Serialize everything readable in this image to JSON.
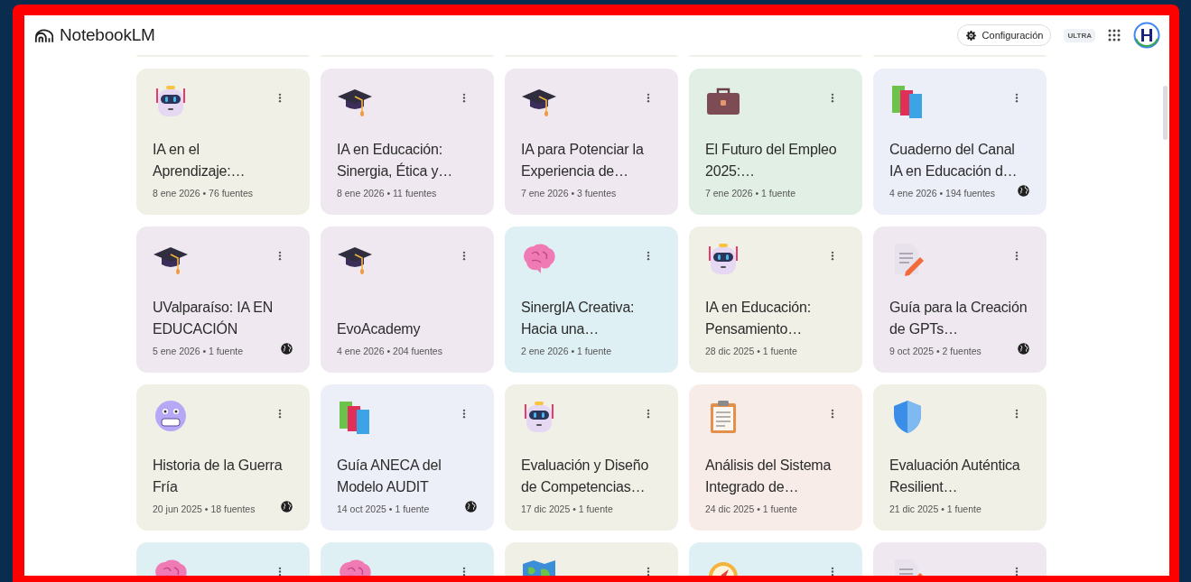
{
  "app": {
    "name": "NotebookLM"
  },
  "header": {
    "settings_label": "Configuración",
    "plan_badge": "ULTRA"
  },
  "notebooks": [
    {
      "kind": "robot",
      "color": "#f1f0e6",
      "title": "IA en el Aprendizaje:…",
      "meta": "8 ene 2026 • 76 fuentes",
      "public": false
    },
    {
      "kind": "cap",
      "color": "#efe8f0",
      "title": "IA en Educación: Sinergia, Ética y…",
      "meta": "8 ene 2026 • 11 fuentes",
      "public": false
    },
    {
      "kind": "cap",
      "color": "#efe8f0",
      "title": "IA para Potenciar la Experiencia de…",
      "meta": "7 ene 2026 • 3 fuentes",
      "public": false
    },
    {
      "kind": "briefcase",
      "color": "#e1efe4",
      "title": "El Futuro del Empleo 2025:…",
      "meta": "7 ene 2026 • 1 fuente",
      "public": false
    },
    {
      "kind": "books",
      "color": "#eceef8",
      "title": "Cuaderno del Canal IA en Educación d…",
      "meta": "4 ene 2026 • 194 fuentes",
      "public": true
    },
    {
      "kind": "cap",
      "color": "#efe8f0",
      "title": "UValparaíso: IA EN EDUCACIÓN",
      "meta": "5 ene 2026 • 1 fuente",
      "public": true
    },
    {
      "kind": "cap",
      "color": "#efe8f0",
      "title": "EvoAcademy",
      "meta": "4 ene 2026 • 204 fuentes",
      "public": false
    },
    {
      "kind": "brain",
      "color": "#dff0f5",
      "title": "SinergIA Creativa: Hacia una…",
      "meta": "2 ene 2026 • 1 fuente",
      "public": false
    },
    {
      "kind": "robot",
      "color": "#f1f0e6",
      "title": "IA en Educación: Pensamiento…",
      "meta": "28 dic 2025 • 1 fuente",
      "public": false
    },
    {
      "kind": "document",
      "color": "#efe8f0",
      "title": "Guía para la Creación de GPTs…",
      "meta": "9 oct 2025 • 2 fuentes",
      "public": true
    },
    {
      "kind": "face",
      "color": "#f1f0e6",
      "title": "Historia de la Guerra Fría",
      "meta": "20 jun 2025 • 18 fuentes",
      "public": true
    },
    {
      "kind": "books",
      "color": "#eceef8",
      "title": "Guía ANECA del Modelo AUDIT",
      "meta": "14 oct 2025 • 1 fuente",
      "public": true
    },
    {
      "kind": "robot",
      "color": "#f1f0e6",
      "title": "Evaluación y Diseño de Competencias…",
      "meta": "17 dic 2025 • 1 fuente",
      "public": false
    },
    {
      "kind": "clipboard",
      "color": "#f7ece8",
      "title": "Análisis del Sistema Integrado de…",
      "meta": "24 dic 2025 • 1 fuente",
      "public": false
    },
    {
      "kind": "shield",
      "color": "#f1f0e6",
      "title": "Evaluación Auténtica Resilient…",
      "meta": "21 dic 2025 • 1 fuente",
      "public": false
    },
    {
      "kind": "brain",
      "color": "#dff0f5"
    },
    {
      "kind": "brain",
      "color": "#dff0f5"
    },
    {
      "kind": "map",
      "color": "#f1f0e6"
    },
    {
      "kind": "compass",
      "color": "#dff0f5"
    },
    {
      "kind": "document",
      "color": "#efe8f0"
    }
  ]
}
